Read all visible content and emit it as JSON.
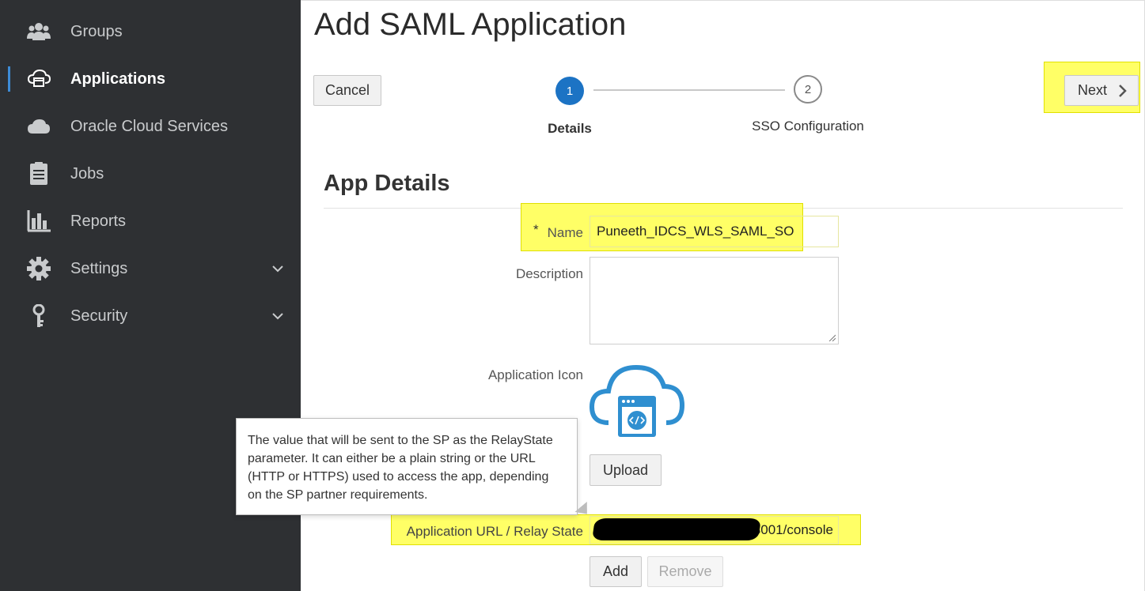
{
  "sidebar": {
    "items": [
      {
        "label": "Groups",
        "icon": "users-icon"
      },
      {
        "label": "Applications",
        "icon": "cloud-app-icon",
        "active": true
      },
      {
        "label": "Oracle Cloud Services",
        "icon": "cloud-icon"
      },
      {
        "label": "Jobs",
        "icon": "clipboard-icon"
      },
      {
        "label": "Reports",
        "icon": "bar-chart-icon"
      },
      {
        "label": "Settings",
        "icon": "gear-icon",
        "expandable": true
      },
      {
        "label": "Security",
        "icon": "key-icon",
        "expandable": true
      }
    ]
  },
  "page": {
    "title": "Add SAML Application"
  },
  "toolbar": {
    "cancel_label": "Cancel",
    "next_label": "Next"
  },
  "wizard": {
    "steps": [
      {
        "number": "1",
        "label": "Details",
        "active": true
      },
      {
        "number": "2",
        "label": "SSO Configuration",
        "active": false
      }
    ]
  },
  "details": {
    "section_title": "App Details",
    "name": {
      "required_mark": "*",
      "label": "Name",
      "value": "Puneeth_IDCS_WLS_SAML_SO"
    },
    "description": {
      "label": "Description",
      "value": ""
    },
    "icon": {
      "label": "Application Icon",
      "upload_label": "Upload"
    },
    "app_url": {
      "label": "Application URL / Relay State",
      "value": "http://:63001/console",
      "visible_suffix": "n:63001/console"
    },
    "add_label": "Add",
    "remove_label": "Remove"
  },
  "tooltip": {
    "text": "The value that will be sent to the SP as the RelayState parameter. It can either be a plain string or the URL (HTTP or HTTPS) used to access the app, depending on the SP partner requirements."
  },
  "colors": {
    "sidebar_bg": "#2e3033",
    "accent": "#1c73c4",
    "highlight": "#ffff66",
    "app_icon_blue": "#2f8fd0"
  }
}
